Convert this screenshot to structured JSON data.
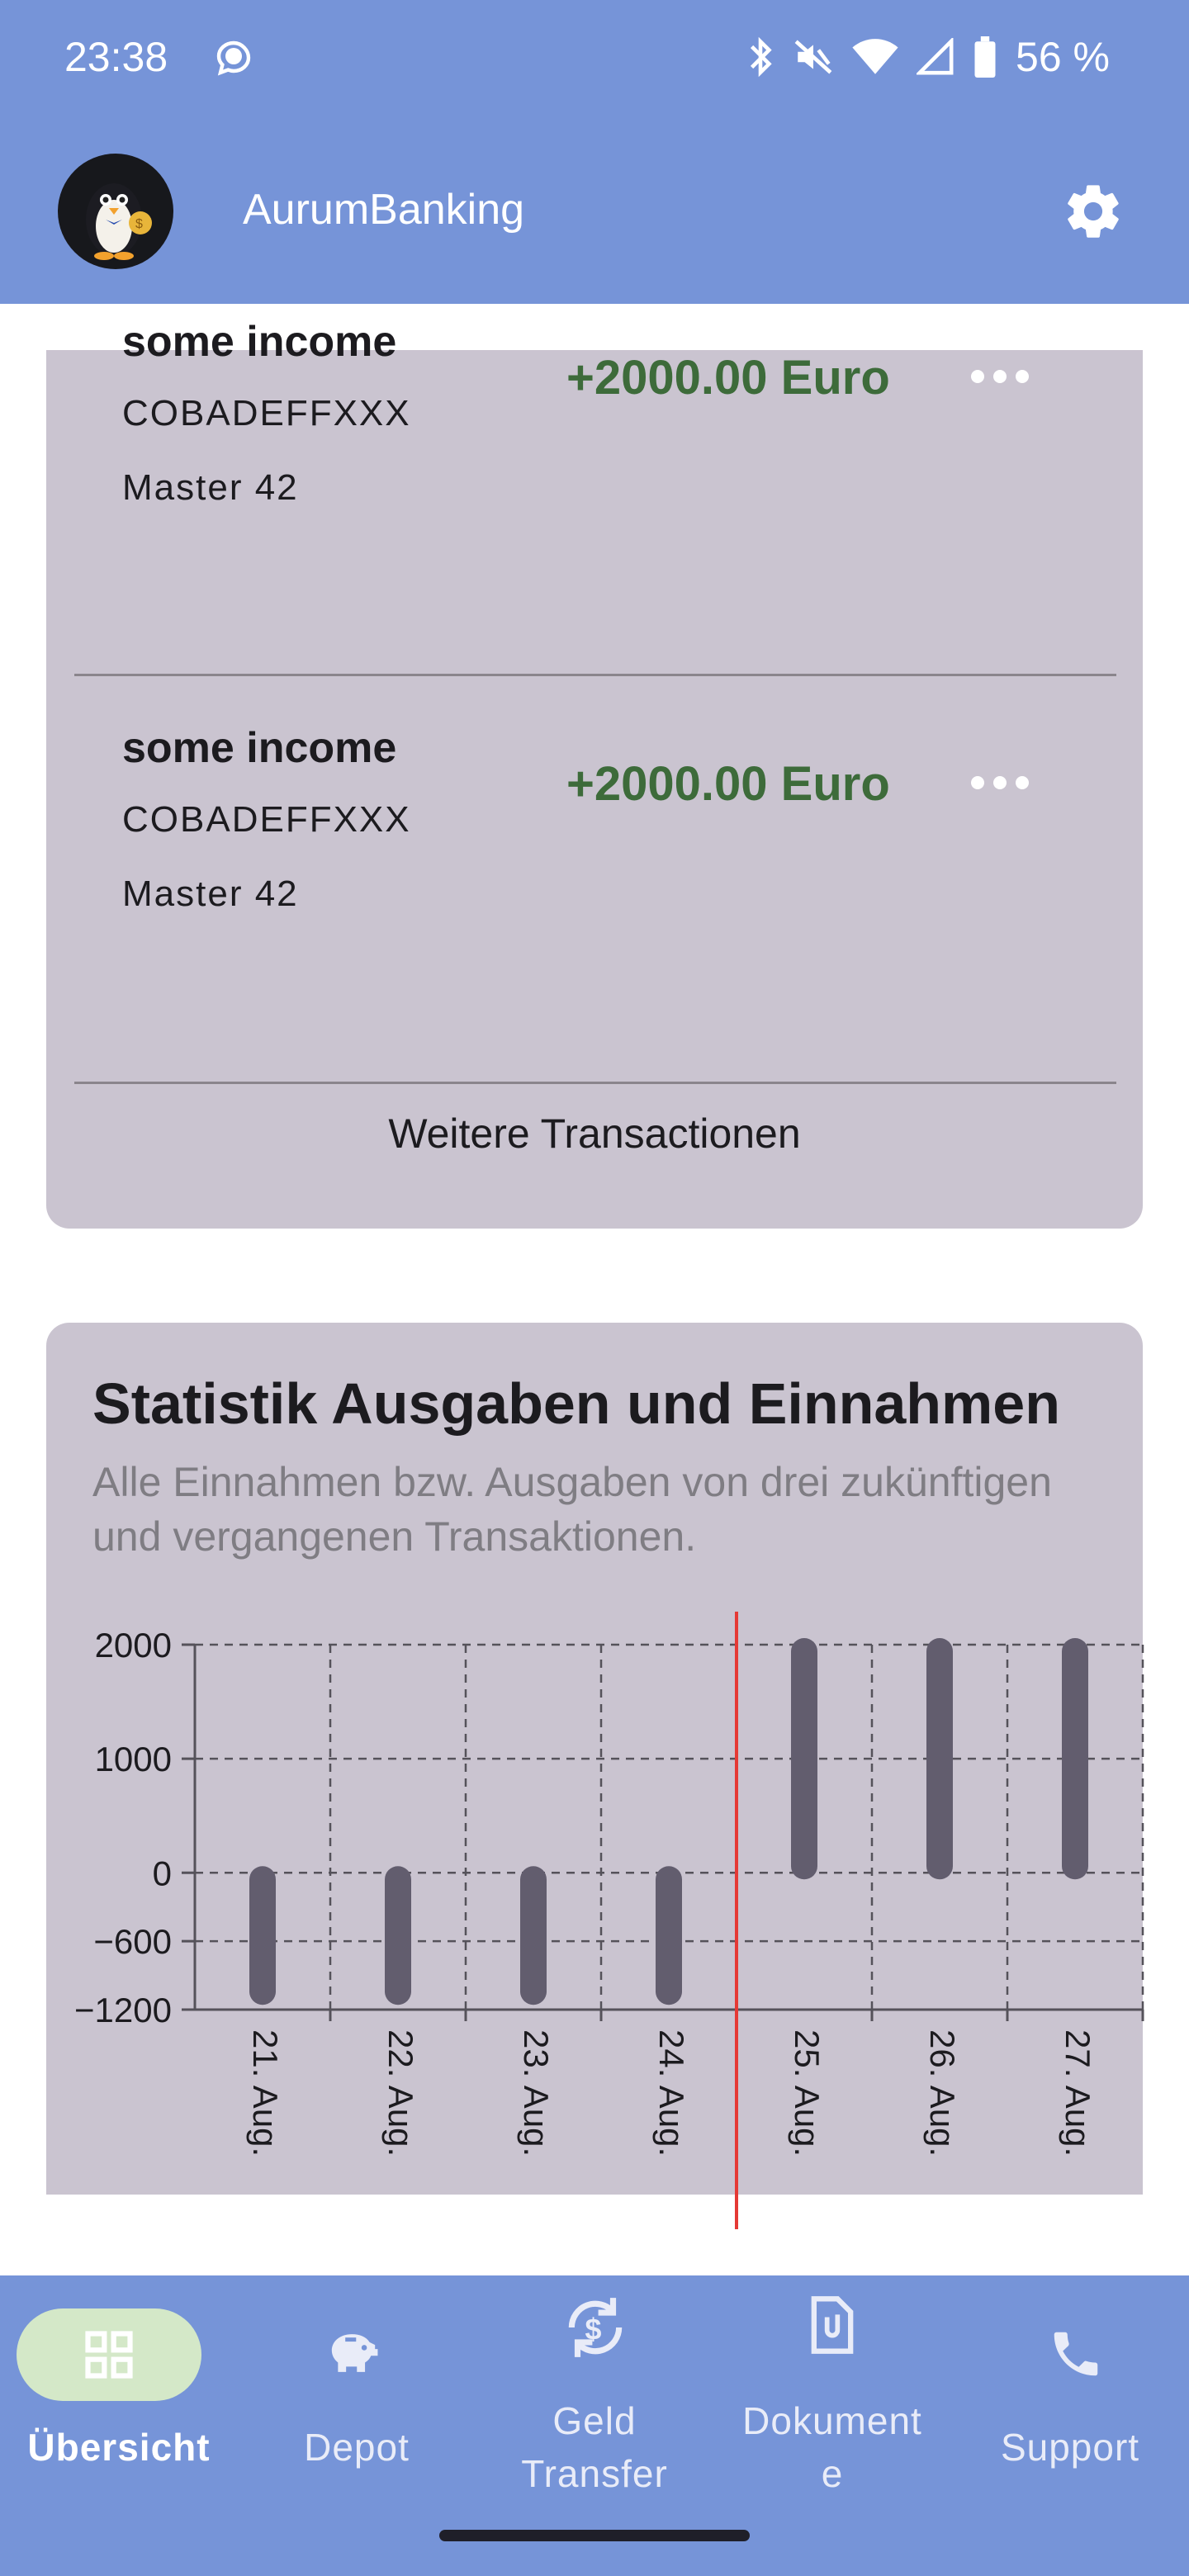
{
  "status": {
    "time": "23:38",
    "battery": "56 %"
  },
  "appbar": {
    "title": "AurumBanking"
  },
  "transactions": [
    {
      "name": "some income",
      "bic": "COBADEFFXXX",
      "account": "Master 42",
      "amount": "+2000.00 Euro"
    },
    {
      "name": "some income",
      "bic": "COBADEFFXXX",
      "account": "Master 42",
      "amount": "+2000.00 Euro"
    }
  ],
  "more_transactions": "Weitere Transactionen",
  "stats": {
    "title": "Statistik Ausgaben und Einnahmen",
    "subtitle": "Alle Einnahmen bzw. Ausgaben von drei zukünftigen und vergangenen Transaktionen."
  },
  "chart_data": {
    "type": "bar",
    "categories": [
      "21. Aug.",
      "22. Aug.",
      "23. Aug.",
      "24. Aug.",
      "25. Aug.",
      "26. Aug.",
      "27. Aug."
    ],
    "values": [
      -1100,
      -1100,
      -1100,
      -1100,
      2000,
      2000,
      2000
    ],
    "ylim": [
      -1200,
      2000
    ],
    "yticks": [
      {
        "value": 2000,
        "label": "2000"
      },
      {
        "value": 1000,
        "label": "1000"
      },
      {
        "value": 0,
        "label": "0"
      },
      {
        "value": -600,
        "label": "-600"
      },
      {
        "value": -1200,
        "label": "-1200"
      }
    ],
    "grid": true,
    "marker_category": "24. Aug.",
    "bar_color": "#625d6e",
    "marker_color": "#e53935"
  },
  "nav": [
    {
      "label": "Übersicht",
      "icon": "grid-icon",
      "active": true
    },
    {
      "label": "Depot",
      "icon": "piggy-bank-icon"
    },
    {
      "label": "Geld Transfer",
      "label_lines": [
        "Geld",
        "Transfer"
      ],
      "icon": "money-transfer-icon"
    },
    {
      "label": "Dokumente",
      "label_lines": [
        "Dokument",
        "e"
      ],
      "icon": "document-icon"
    },
    {
      "label": "Support",
      "icon": "phone-icon"
    }
  ],
  "colors": {
    "primary": "#7694d8",
    "card": "#cac4d0",
    "income": "#3d6b3a",
    "active_pill": "#d4e8c8"
  }
}
